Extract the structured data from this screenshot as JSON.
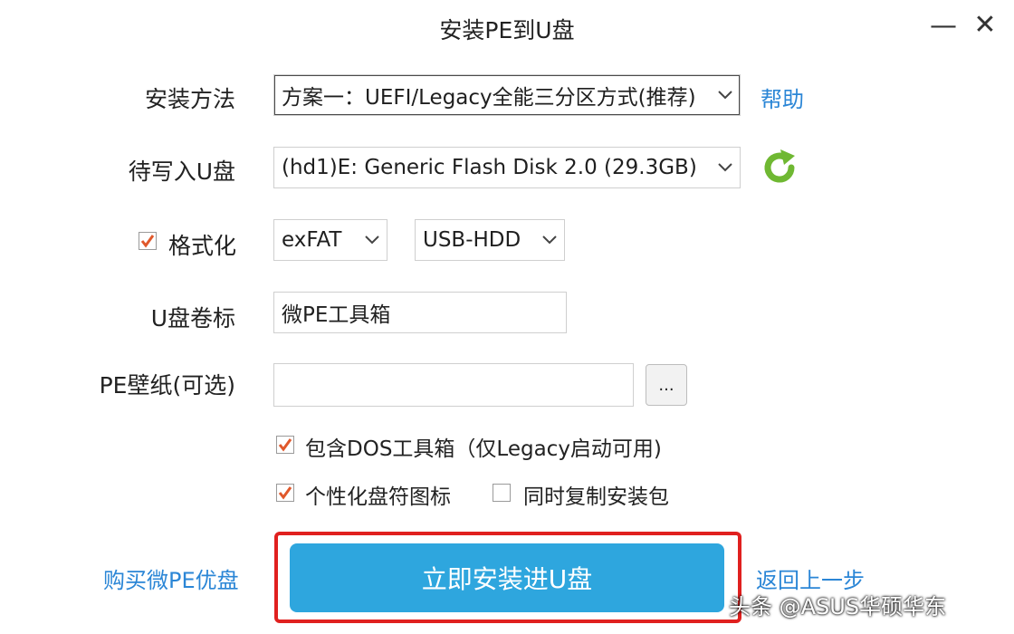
{
  "window": {
    "title": "安装PE到U盘",
    "minimize_glyph": "—",
    "close_glyph": "✕"
  },
  "install_method": {
    "label": "安装方法",
    "value": "方案一：UEFI/Legacy全能三分区方式(推荐)",
    "help_link": "帮助"
  },
  "target_disk": {
    "label": "待写入U盘",
    "value": "(hd1)E: Generic Flash Disk 2.0 (29.3GB)",
    "refresh_icon": "refresh-icon"
  },
  "format": {
    "label": "格式化",
    "checked": true,
    "filesystem": "exFAT",
    "mode": "USB-HDD"
  },
  "volume_label": {
    "label": "U盘卷标",
    "value": "微PE工具箱"
  },
  "wallpaper": {
    "label": "PE壁纸(可选)",
    "value": "",
    "browse_label": "..."
  },
  "options": {
    "dos_toolbox": {
      "label": "包含DOS工具箱（仅Legacy启动可用)",
      "checked": true
    },
    "custom_icons": {
      "label": "个性化盘符图标",
      "checked": true
    },
    "copy_package": {
      "label": "同时复制安装包",
      "checked": false
    }
  },
  "footer": {
    "buy_link": "购买微PE优盘",
    "install_button": "立即安装进U盘",
    "back_link": "返回上一步"
  },
  "watermark": "头条 @ASUS华硕华东",
  "colors": {
    "accent": "#2ea6de",
    "link": "#2b86d6",
    "highlight": "#e0201f",
    "check": "#e0582b",
    "refresh": "#7cc142"
  }
}
